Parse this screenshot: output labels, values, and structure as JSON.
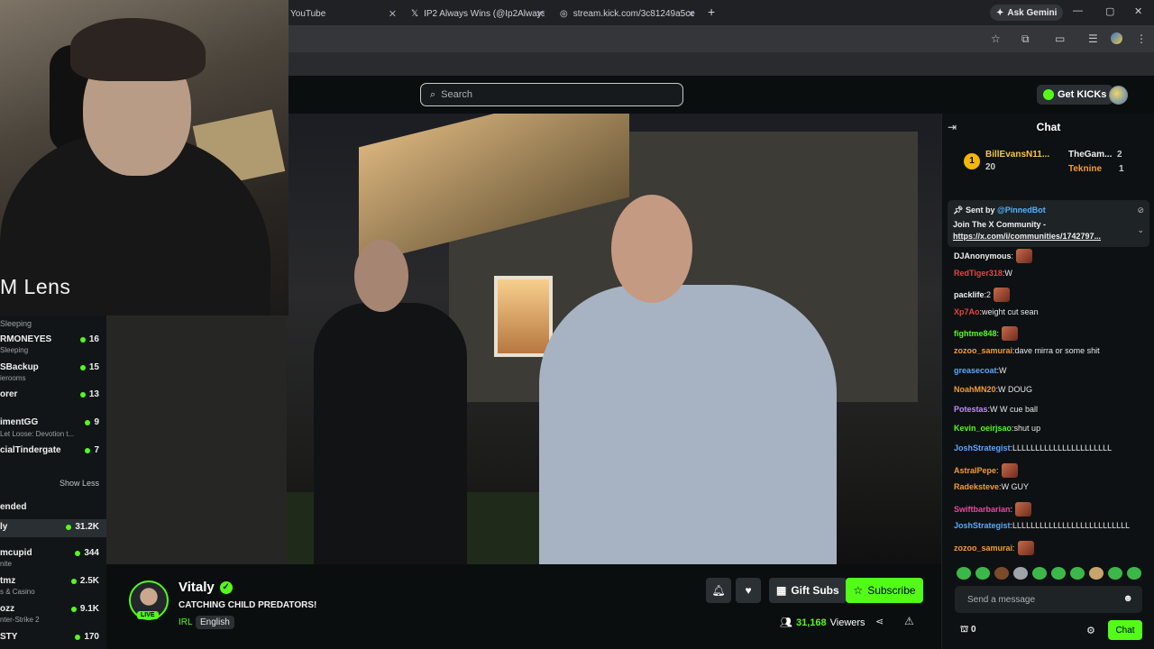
{
  "browser": {
    "tabs": [
      {
        "label": "YouTube"
      },
      {
        "label": "IP2 Always Wins (@Ip2AlwaysWi"
      },
      {
        "label": "stream.kick.com/3c81249a5ce0"
      }
    ],
    "new_tab": "+",
    "ask_gemini": "Ask Gemini"
  },
  "webcam": {
    "watermark": "M Lens"
  },
  "search": {
    "placeholder": "Search"
  },
  "header": {
    "get_kicks": "Get KICKs"
  },
  "sidebar": {
    "following": [
      {
        "name": "",
        "sub": "Sleeping",
        "count": ""
      },
      {
        "name": "RMONEYES",
        "sub": "Sleeping",
        "count": "16"
      },
      {
        "name": "SBackup",
        "sub": "ierooms",
        "count": "15"
      },
      {
        "name": "orer",
        "sub": "",
        "count": "13"
      },
      {
        "name": "imentGG",
        "sub": "Let Loose: Devotion t...",
        "count": "9"
      },
      {
        "name": "cialTindergate",
        "sub": "",
        "count": "7"
      }
    ],
    "show_less": "Show Less",
    "recommended_label": "ended",
    "recommended": [
      {
        "name": "ly",
        "sub": "",
        "count": "31.2K"
      },
      {
        "name": "mcupid",
        "sub": "nite",
        "count": "344"
      },
      {
        "name": "tmz",
        "sub": "s & Casino",
        "count": "2.5K"
      },
      {
        "name": "ozz",
        "sub": "nter-Strike 2",
        "count": "9.1K"
      },
      {
        "name": "STY",
        "sub": "",
        "count": "170"
      }
    ]
  },
  "stream": {
    "channel": "Vitaly",
    "live_label": "LIVE",
    "title": "CATCHING CHILD PREDATORS!",
    "category": "IRL",
    "language": "English",
    "gift_subs": "Gift Subs",
    "subscribe": "Subscribe",
    "viewers_count": "31,168",
    "viewers_label": "Viewers"
  },
  "chat": {
    "title": "Chat",
    "leaderboard": [
      {
        "rank": "1",
        "name": "BillEvansN11...",
        "value": "20"
      },
      {
        "name": "TheGam...",
        "value": "2"
      },
      {
        "name": "Teknine",
        "value": "1"
      }
    ],
    "pinned": {
      "sent_by": "Sent by",
      "bot": "@PinnedBot",
      "text": "Join The X Community -",
      "link": "https://x.com/i/communities/1742797..."
    },
    "messages": [
      {
        "user": "DJAnonymous",
        "text": "",
        "emote": true,
        "color": "#f0f0f0"
      },
      {
        "user": "RedTiger318",
        "text": "W",
        "emote": false,
        "color": "#e84343"
      },
      {
        "user": "packlife",
        "text": "2",
        "emote": true,
        "color": "#f0f0f0"
      },
      {
        "user": "Xp7Ao",
        "text": "weight cut sean",
        "emote": false,
        "color": "#e84343"
      },
      {
        "user": "fightme848",
        "text": "",
        "emote": true,
        "color": "#53fc18"
      },
      {
        "user": "zozoo_samurai",
        "text": "dave mirra or some shit",
        "emote": false,
        "color": "#f39c3a"
      },
      {
        "user": "greasecoat",
        "text": "W",
        "emote": false,
        "color": "#5aa9ff"
      },
      {
        "user": "NoahMN20",
        "text": "W DOUG",
        "emote": false,
        "color": "#f39c3a"
      },
      {
        "user": "Potestas",
        "text": "W W cue ball",
        "emote": false,
        "color": "#c28cff"
      },
      {
        "user": "Kevin_oeirjsao",
        "text": "shut up",
        "emote": false,
        "color": "#53fc18"
      },
      {
        "user": "JoshStrategist",
        "text": "LLLLLLLLLLLLLLLLLLLLLL",
        "emote": false,
        "color": "#5aa9ff"
      },
      {
        "user": "AstralPepe",
        "text": "",
        "emote": true,
        "color": "#f39c3a"
      },
      {
        "user": "Radeksteve",
        "text": "W GUY",
        "emote": false,
        "color": "#f39c3a"
      },
      {
        "user": "Swiftbarbarian",
        "text": "",
        "emote": true,
        "color": "#e84a9c"
      },
      {
        "user": "JoshStrategist",
        "text": "LLLLLLLLLLLLLLLLLLLLLLLLLL",
        "emote": false,
        "color": "#5aa9ff"
      },
      {
        "user": "zozoo_samurai",
        "text": "",
        "emote": true,
        "color": "#f39c3a"
      }
    ],
    "send_placeholder": "Send a message",
    "points": "0",
    "chat_button": "Chat"
  },
  "colors": {
    "accent": "#53fc18",
    "background": "#0b0e0f"
  }
}
